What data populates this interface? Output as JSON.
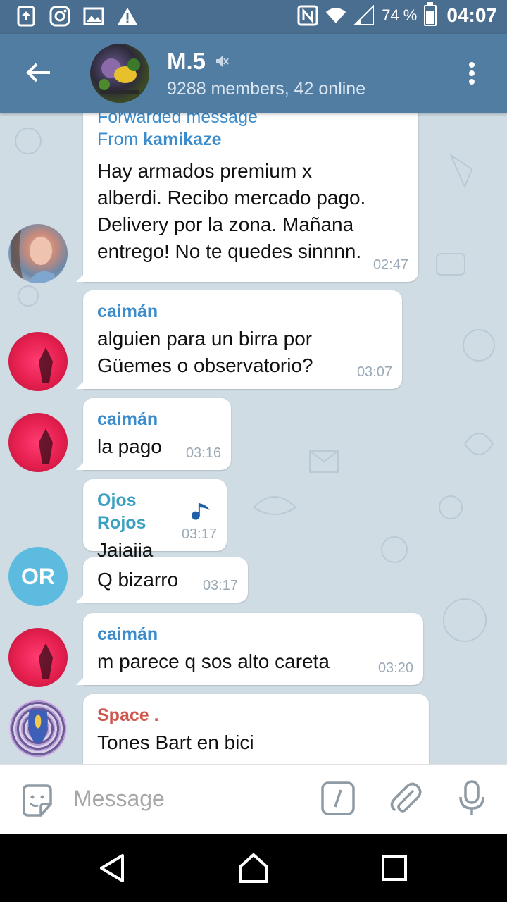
{
  "status_bar": {
    "battery_text": "74 %",
    "battery_level": 0.74,
    "time": "04:07",
    "icons": [
      "upload-icon",
      "instagram-icon",
      "image-icon",
      "warning-icon",
      "nfc-icon",
      "wifi-icon",
      "signal-icon",
      "battery-icon"
    ]
  },
  "header": {
    "title": "M.5",
    "muted": true,
    "subtitle": "9288 members, 42 online"
  },
  "messages": [
    {
      "forwarded_label": "Forwarded message",
      "from_prefix": "From",
      "from_name": "kamikaze",
      "text": "Hay armados premium x\nalberdi. Recibo mercado pago.\nDelivery por la zona. Mañana\nentrego! No te quedes sinnnn.",
      "time": "02:47",
      "avatar": "girl-photo"
    },
    {
      "sender": "caimán",
      "sender_color": "#3a8ccc",
      "text": "alguien para un birra por\nGüemes o observatorio?",
      "time": "03:07",
      "avatar": "red-feather"
    },
    {
      "sender": "caimán",
      "sender_color": "#3a8ccc",
      "text": "la pago",
      "time": "03:16",
      "avatar": "red-feather"
    },
    {
      "sender": "Ojos Rojos",
      "sender_color": "#3aa0c0",
      "text": "Jajajja",
      "time": "03:17"
    },
    {
      "text": "Q bizarro",
      "time": "03:17",
      "avatar_initials": "OR"
    },
    {
      "sender": "caimán",
      "sender_color": "#3a8ccc",
      "text": "m parece q sos alto careta",
      "time": "03:20",
      "avatar": "red-feather"
    },
    {
      "sender": "Space .",
      "sender_color": "#d0574f",
      "text": "Tones Bart en bici",
      "avatar": "psychedelic"
    }
  ],
  "input": {
    "placeholder": "Message"
  }
}
